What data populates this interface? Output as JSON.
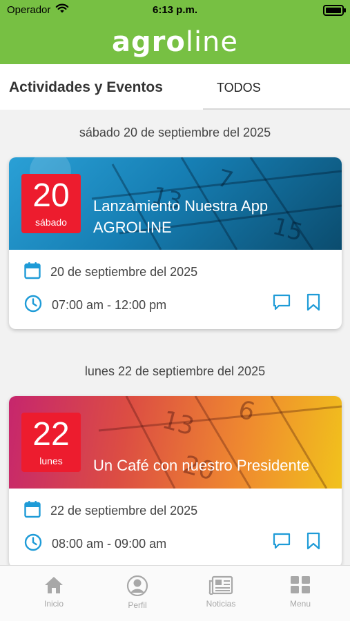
{
  "status": {
    "carrier": "Operador",
    "time": "6:13 p.m."
  },
  "header": {
    "logo_bold": "agro",
    "logo_light": "line"
  },
  "tabs": {
    "title": "Actividades y  Eventos",
    "filter": "TODOS"
  },
  "groups": [
    {
      "heading": "sábado 20 de septiembre del 2025",
      "event": {
        "day": "20",
        "weekday": "sábado",
        "title_line1": "Lanzamiento Nuestra App",
        "title_line2": "AGROLINE",
        "date": "20 de septiembre del 2025",
        "time": "07:00 am - 12:00 pm"
      }
    },
    {
      "heading": "lunes 22 de septiembre del 2025",
      "event": {
        "day": "22",
        "weekday": "lunes",
        "title_line1": "Un Café con nuestro Presidente",
        "date": "22 de septiembre del 2025",
        "time": "08:00 am - 09:00 am"
      }
    }
  ],
  "tabbar": {
    "items": [
      {
        "label": "Inicio",
        "icon": "home-icon"
      },
      {
        "label": "Perfil",
        "icon": "profile-icon"
      },
      {
        "label": "Noticias",
        "icon": "newspaper-icon"
      },
      {
        "label": "Menu",
        "icon": "grid-icon"
      }
    ]
  },
  "colors": {
    "brand_green": "#77c043",
    "accent_blue": "#1e9bd7",
    "date_red": "#ed1c2e"
  }
}
